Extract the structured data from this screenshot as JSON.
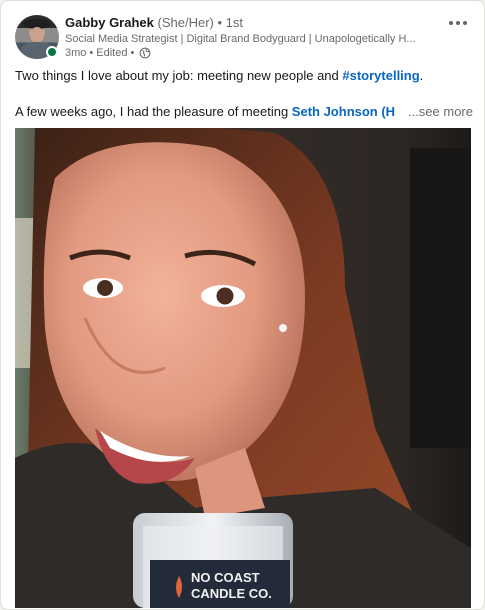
{
  "author": {
    "name": "Gabby Grahek",
    "pronouns": "(She/Her)",
    "degree": "1st",
    "degree_separator": "•",
    "headline": "Social Media Strategist | Digital Brand Bodyguard | Unapologetically H...",
    "time_ago": "3mo",
    "edited": "Edited",
    "meta_separator": "•",
    "visibility_icon": "globe-icon",
    "online": true
  },
  "post": {
    "line1_text": "Two things I love about my job: meeting new people and ",
    "hashtag": "#storytelling",
    "line1_end": ".",
    "line2_text": "A few weeks ago, I had the pleasure of meeting ",
    "mention": "Seth Johnson (H",
    "see_more": "...see more"
  },
  "image": {
    "candle_label_line1": "NO COAST",
    "candle_label_line2": "CANDLE CO."
  },
  "colors": {
    "link": "#0a66c2",
    "online": "#057642",
    "card": "#ffffff"
  }
}
